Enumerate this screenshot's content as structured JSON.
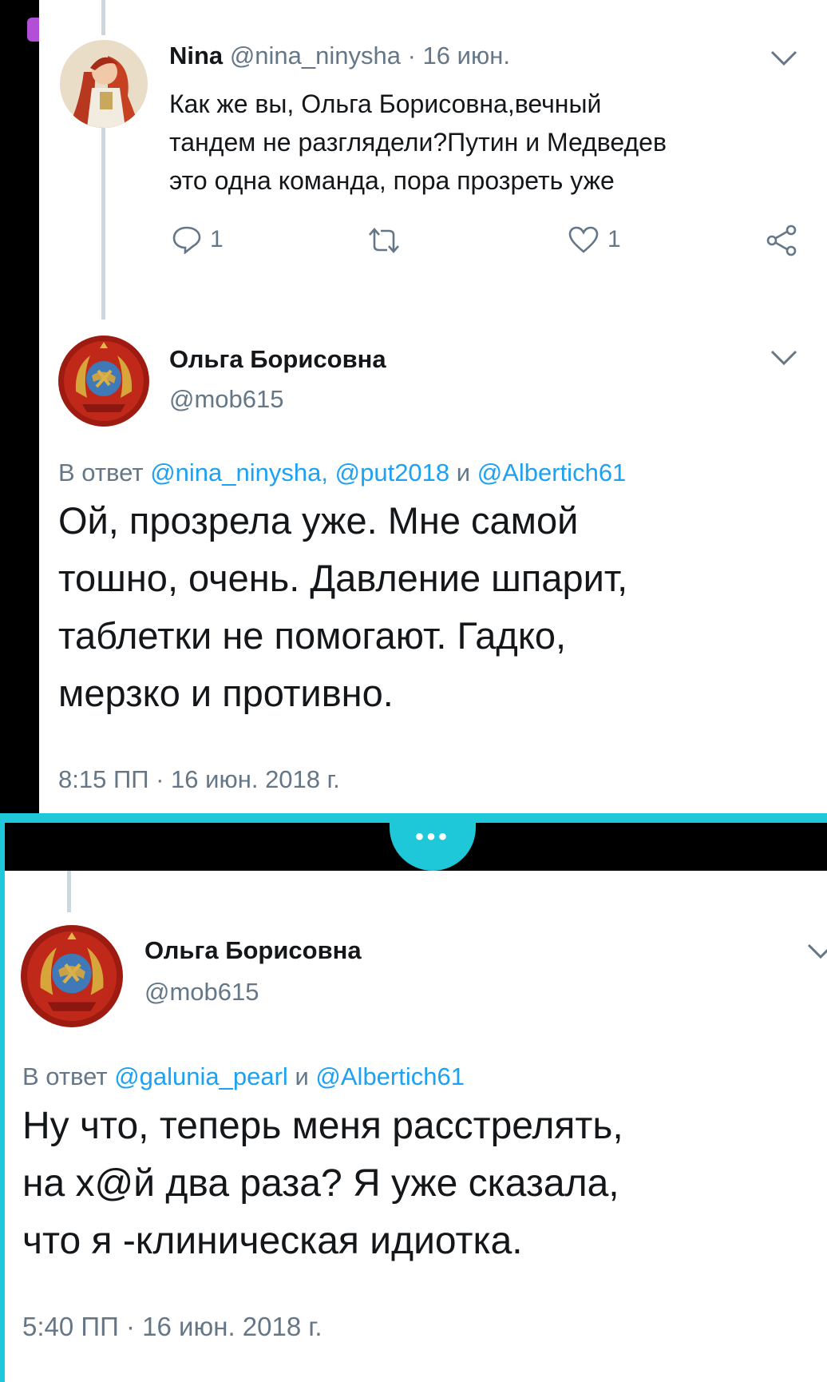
{
  "tweet1": {
    "name": "Nina",
    "handle": "@nina_ninysha",
    "date": "· 16 июн.",
    "text_lines": [
      "Как же вы, Ольга Борисовна,вечный",
      "тандем не разглядели?Путин и Медведев",
      "это одна команда, пора прозреть уже"
    ],
    "reply_count": "1",
    "like_count": "1"
  },
  "tweet2": {
    "name": "Ольга Борисовна",
    "handle": "@mob615",
    "reply_prefix": "В ответ",
    "reply_mentions": [
      "@nina_ninysha,",
      "@put2018"
    ],
    "reply_and": "и",
    "reply_last": "@Albertich61",
    "text_lines": [
      "Ой, прозрела уже. Мне самой",
      "тошно, очень. Давление шпарит,",
      "таблетки не помогают. Гадко,",
      "мерзко и противно."
    ],
    "timestamp": "8:15 ПП · 16 июн. 2018 г."
  },
  "more_button": {
    "label": "•••"
  },
  "tweet3": {
    "name": "Ольга Борисовна",
    "handle": "@mob615",
    "reply_prefix": "В ответ",
    "reply_first": "@galunia_pearl",
    "reply_and": "и",
    "reply_last": "@Albertich61",
    "text_lines": [
      "Ну что, теперь меня расстрелять,",
      "на х@й два раза? Я уже сказала,",
      "что я -клиническая идиотка."
    ],
    "timestamp": "5:40 ПП · 16 июн. 2018 г."
  },
  "colors": {
    "link": "#1da1f2",
    "gray": "#657786",
    "accent_band": "#1ec8d8",
    "text": "#14171a"
  },
  "icons": [
    "reply-icon",
    "retweet-icon",
    "like-icon",
    "share-icon",
    "chevron-down-icon",
    "soviet-emblem-avatar",
    "nina-avatar"
  ]
}
